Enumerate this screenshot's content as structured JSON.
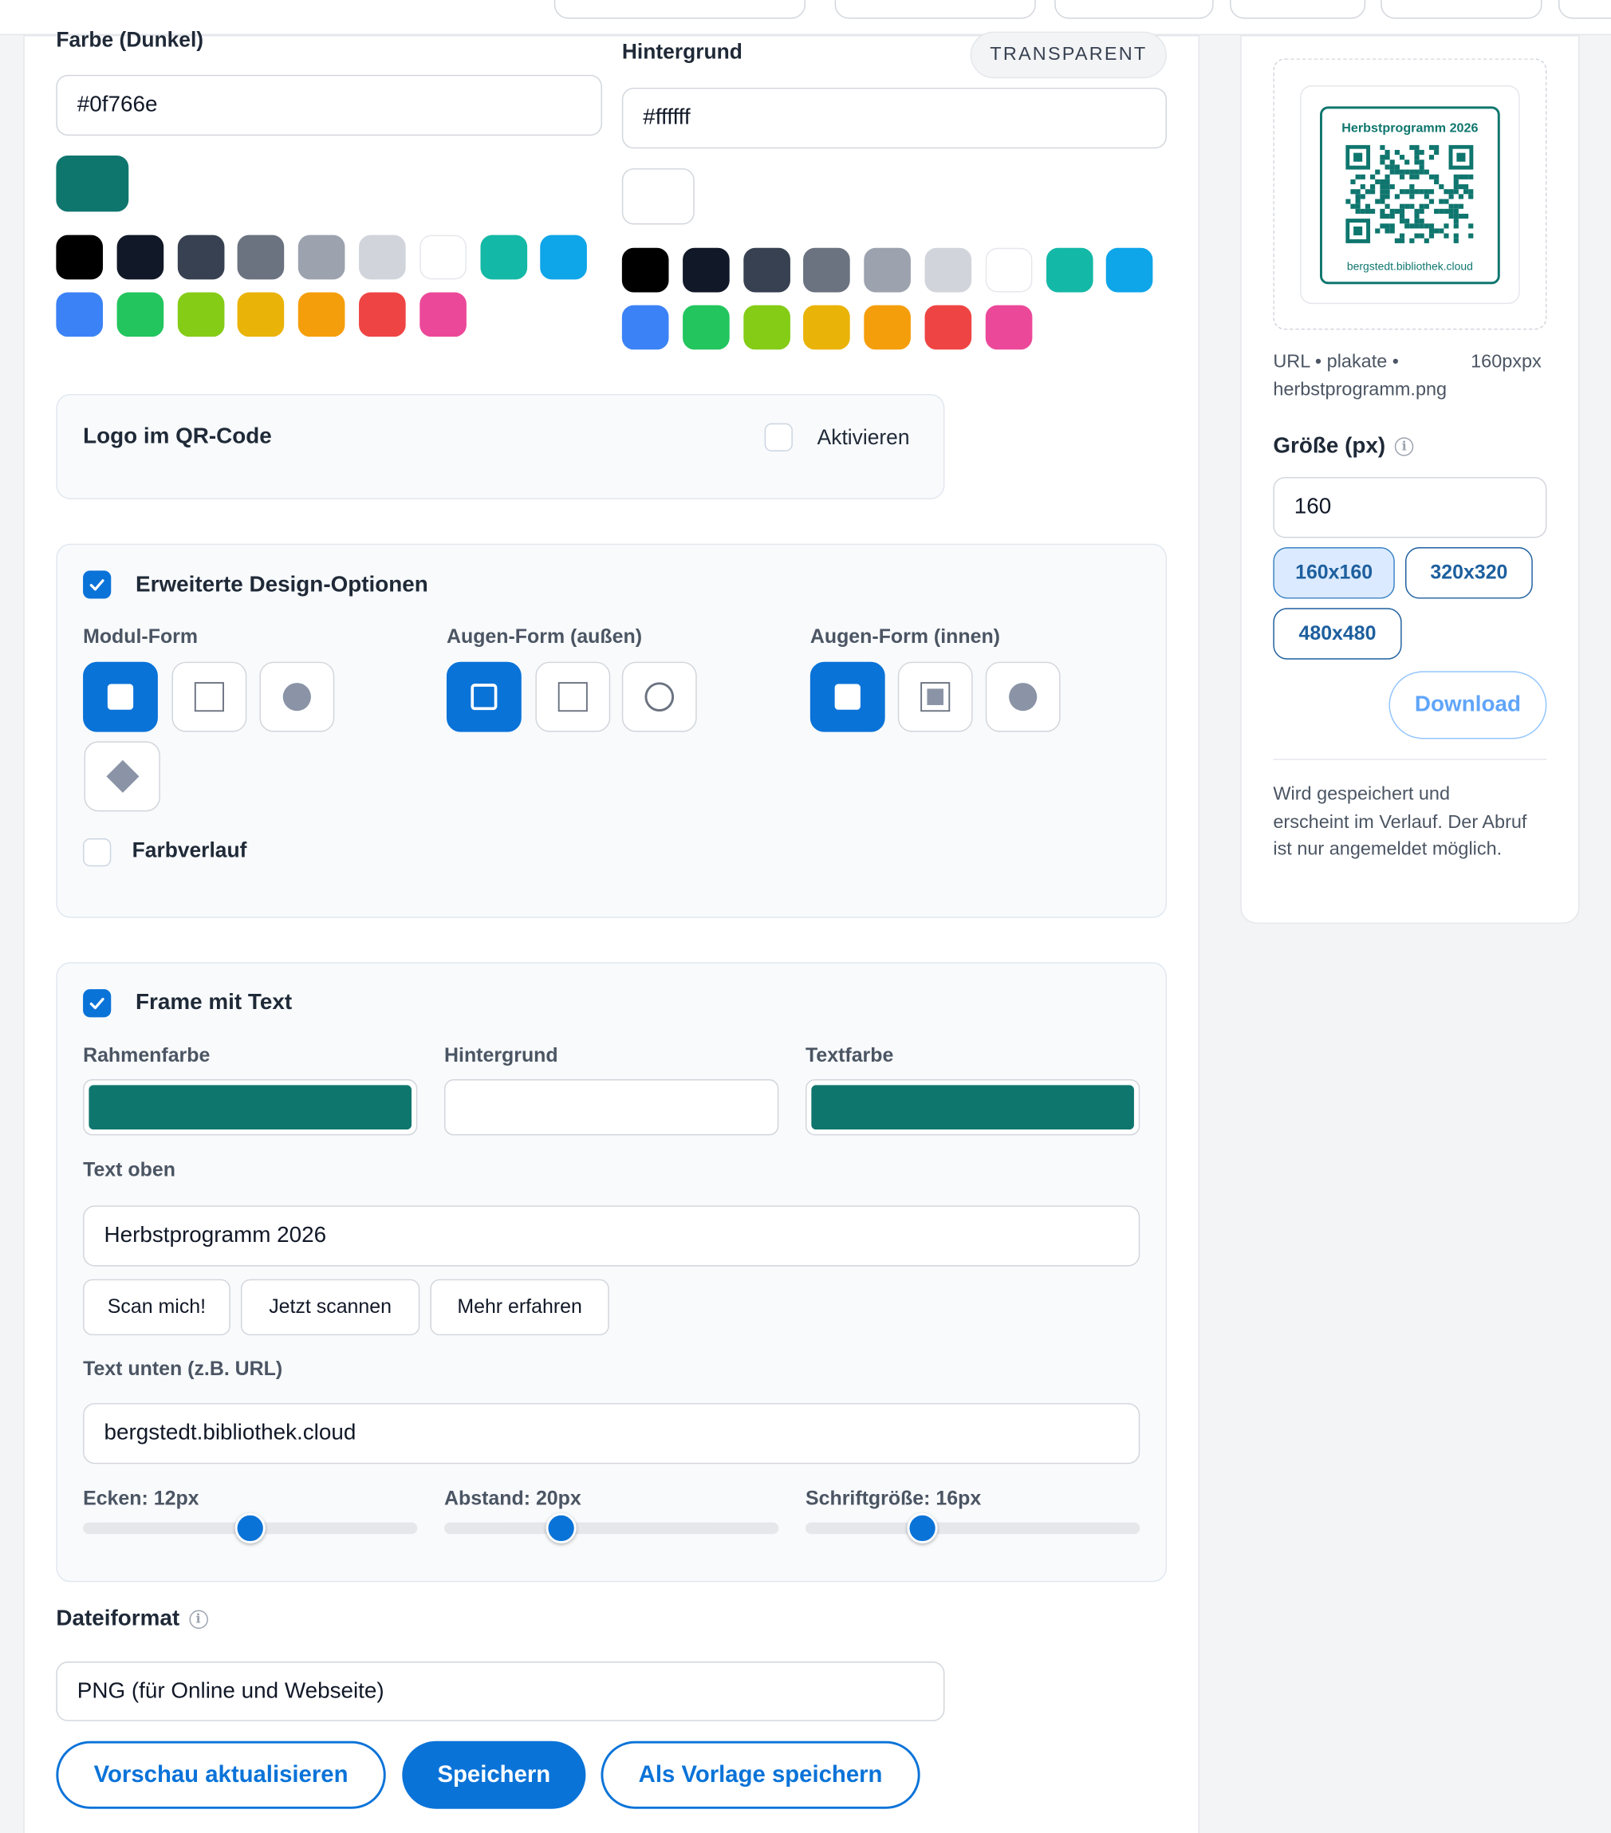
{
  "colors": {
    "accent": "#0a73d8",
    "brand": "#0f766e",
    "palette": [
      "#000000",
      "#111827",
      "#374151",
      "#6b7280",
      "#9ca3af",
      "#d1d5db",
      "#ffffff",
      "#14b8a6",
      "#0ea5e9",
      "#3b82f6",
      "#22c55e",
      "#84cc16",
      "#eab308",
      "#f59e0b",
      "#ef4444",
      "#ec4899"
    ]
  },
  "dark_color": {
    "label": "Farbe (Dunkel)",
    "value": "#0f766e"
  },
  "background": {
    "label": "Hintergrund",
    "transparent_label": "TRANSPARENT",
    "value": "#ffffff"
  },
  "logo": {
    "title": "Logo im QR-Code",
    "activate_label": "Aktivieren"
  },
  "design": {
    "title": "Erweiterte Design-Optionen",
    "module_label": "Modul-Form",
    "eye_outer_label": "Augen-Form (außen)",
    "eye_inner_label": "Augen-Form (innen)",
    "gradient_label": "Farbverlauf"
  },
  "frame": {
    "title": "Frame mit Text",
    "border_color_label": "Rahmenfarbe",
    "bg_label": "Hintergrund",
    "text_color_label": "Textfarbe",
    "border_color": "#0f766e",
    "bg_color": "#ffffff",
    "text_color": "#0f766e",
    "text_top_label": "Text oben",
    "text_top_value": "Herbstprogramm 2026",
    "presets": [
      "Scan mich!",
      "Jetzt scannen",
      "Mehr erfahren"
    ],
    "text_bottom_label": "Text unten (z.B. URL)",
    "text_bottom_value": "bergstedt.bibliothek.cloud",
    "corners_label": "Ecken: 12px",
    "spacing_label": "Abstand: 20px",
    "font_size_label": "Schriftgröße: 16px",
    "corners_value": 12,
    "spacing_value": 20,
    "font_size_value": 16
  },
  "file_format": {
    "label": "Dateiformat",
    "value": "PNG (für Online und Webseite)"
  },
  "actions": {
    "refresh": "Vorschau aktualisieren",
    "save": "Speichern",
    "save_template": "Als Vorlage speichern"
  },
  "preview": {
    "frame_top": "Herbstprogramm 2026",
    "frame_bottom": "bergstedt.bibliothek.cloud",
    "meta_left": "URL • plakate • herbstprogramm.png",
    "meta_right": "160pxpx",
    "size_label": "Größe (px)",
    "size_value": "160",
    "sizes": [
      "160x160",
      "320x320",
      "480x480"
    ],
    "download": "Download",
    "note": "Wird gespeichert und erscheint im Verlauf. Der Abruf ist nur angemeldet möglich."
  }
}
